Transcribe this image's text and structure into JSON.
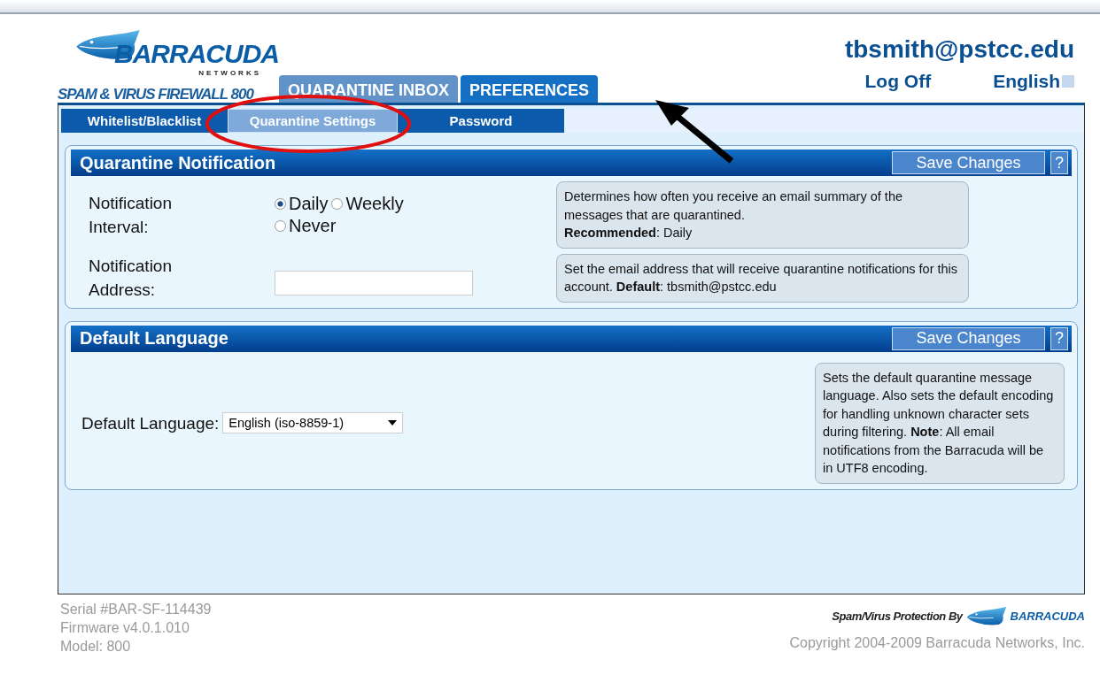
{
  "header": {
    "logo_text": "BARRACUDA",
    "logo_subtext": "NETWORKS",
    "product": "SPAM & VIRUS FIREWALL 800",
    "user": "tbsmith@pstcc.edu",
    "logoff": "Log Off",
    "language": "English"
  },
  "tabs": [
    {
      "label": "QUARANTINE INBOX",
      "selected": false
    },
    {
      "label": "PREFERENCES",
      "selected": true
    }
  ],
  "subtabs": [
    {
      "label": "Whitelist/Blacklist",
      "selected": false
    },
    {
      "label": "Quarantine Settings",
      "selected": true
    },
    {
      "label": "Password",
      "selected": false
    }
  ],
  "panels": [
    {
      "title": "Quarantine Notification",
      "save": "Save Changes",
      "help": "?",
      "rows": [
        {
          "kind": "radio",
          "label": "Notification Interval:",
          "options": [
            {
              "label": "Daily",
              "selected": true
            },
            {
              "label": "Weekly",
              "selected": false
            },
            {
              "label": "Never",
              "selected": false
            }
          ],
          "help": "Determines how often you receive an email summary of the messages that are quarantined.\n**Recommended**: Daily"
        },
        {
          "kind": "text",
          "label": "Notification Address:",
          "help": "Set the email address that will receive quarantine notifications for this account. **Default**: tbsmith@pstcc.edu"
        }
      ]
    },
    {
      "title": "Default Language",
      "save": "Save Changes",
      "help": "?",
      "rows": [
        {
          "kind": "select",
          "label": "Default Language:",
          "value": "English (iso-8859-1)",
          "help": "Sets the default quarantine message language. Also sets the default encoding for handling unknown character sets during filtering. **Note**: All email notifications from the Barracuda will be in UTF8 encoding."
        }
      ]
    }
  ],
  "footer": {
    "info": [
      "Serial #BAR-SF-114439",
      "Firmware v4.0.1.010",
      "Model: 800"
    ],
    "protection": "Spam/Virus Protection By",
    "brand": "BARRACUDA",
    "copyright": "Copyright 2004-2009 Barracuda Networks, Inc."
  }
}
